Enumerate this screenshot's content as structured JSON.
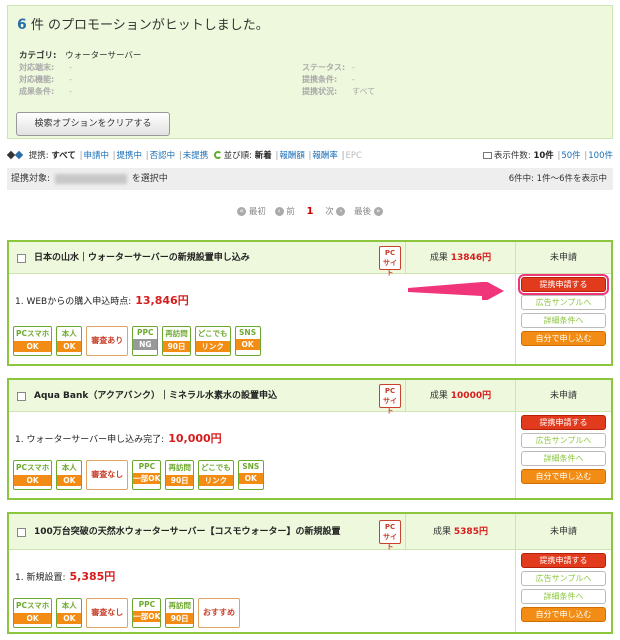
{
  "summary": {
    "count": "6",
    "title_suffix": "件 のプロモーションがヒットしました。",
    "category_label": "カテゴリ:",
    "category_value": "ウォーターサーバー",
    "left_rows": [
      {
        "label": "対応端末:",
        "value": "-"
      },
      {
        "label": "対応機能:",
        "value": "-"
      },
      {
        "label": "成果条件:",
        "value": "-"
      }
    ],
    "right_rows": [
      {
        "label": "ステータス:",
        "value": "-"
      },
      {
        "label": "提携条件:",
        "value": "-"
      },
      {
        "label": "提携状況:",
        "value": "すべて"
      }
    ],
    "clear_button": "検索オプションをクリアする"
  },
  "filters": {
    "affiliation_label": "提携:",
    "affiliation_items": [
      "すべて",
      "申請中",
      "提携中",
      "否認中",
      "未提携"
    ],
    "sort_label": "並び順:",
    "sort_items": [
      "新着",
      "報酬額",
      "報酬率",
      "EPC"
    ],
    "per_page_label": "表示件数:",
    "per_page_items": [
      "10件",
      "50件",
      "100件"
    ]
  },
  "target": {
    "prefix": "提携対象:",
    "suffix": "を選択中",
    "range": "6件中: 1件〜6件を表示中"
  },
  "pager": {
    "first": "最初",
    "prev": "前",
    "current": "1",
    "next": "次",
    "last": "最後"
  },
  "cards": [
    {
      "title": "日本の山水｜ウォーターサーバーの新規設置申し込み",
      "pc_l1": "PC",
      "pc_l2": "サイト",
      "reward_label": "成果",
      "reward_value": "13846円",
      "status": "未申請",
      "condition": "1. WEBからの購入申込時点:",
      "condition_amount": "13,846円",
      "tags": [
        {
          "top": "PCスマホ",
          "bottom": "OK"
        },
        {
          "top": "本人",
          "bottom": "OK"
        },
        {
          "plain": "審査あり"
        },
        {
          "top": "PPC",
          "bottom": "NG",
          "gray": true
        },
        {
          "top": "再訪問",
          "bottom": "90日"
        },
        {
          "top": "どこでも",
          "bottom": "リンク"
        },
        {
          "top": "SNS",
          "bottom": "OK"
        }
      ]
    },
    {
      "title": "Aqua Bank（アクアバンク）｜ミネラル水素水の設置申込",
      "pc_l1": "PC",
      "pc_l2": "サイト",
      "reward_label": "成果",
      "reward_value": "10000円",
      "status": "未申請",
      "condition": "1. ウォーターサーバー申し込み完了:",
      "condition_amount": "10,000円",
      "tags": [
        {
          "top": "PCスマホ",
          "bottom": "OK"
        },
        {
          "top": "本人",
          "bottom": "OK"
        },
        {
          "plain": "審査なし"
        },
        {
          "top": "PPC",
          "bottom": "一部OK"
        },
        {
          "top": "再訪問",
          "bottom": "90日"
        },
        {
          "top": "どこでも",
          "bottom": "リンク"
        },
        {
          "top": "SNS",
          "bottom": "OK"
        }
      ]
    },
    {
      "title": "100万台突破の天然水ウォーターサーバー【コスモウォーター】の新規設置",
      "pc_l1": "PC",
      "pc_l2": "サイト",
      "reward_label": "成果",
      "reward_value": "5385円",
      "status": "未申請",
      "condition": "1. 新規設置:",
      "condition_amount": "5,385円",
      "tags": [
        {
          "top": "PCスマホ",
          "bottom": "OK"
        },
        {
          "top": "本人",
          "bottom": "OK"
        },
        {
          "plain": "審査なし"
        },
        {
          "top": "PPC",
          "bottom": "一部OK"
        },
        {
          "top": "再訪問",
          "bottom": "90日"
        },
        {
          "plain": "おすすめ"
        }
      ]
    }
  ],
  "action_buttons": {
    "apply": "提携申請する",
    "sample": "広告サンプルへ",
    "details": "詳細条件へ",
    "self": "自分で申し込む"
  },
  "colors": {
    "accent_green": "#8cc63f",
    "apply_red": "#e23a1c",
    "self_orange": "#f28c14",
    "highlight_pink": "#f0357a",
    "reward_red": "#d61c1c"
  }
}
